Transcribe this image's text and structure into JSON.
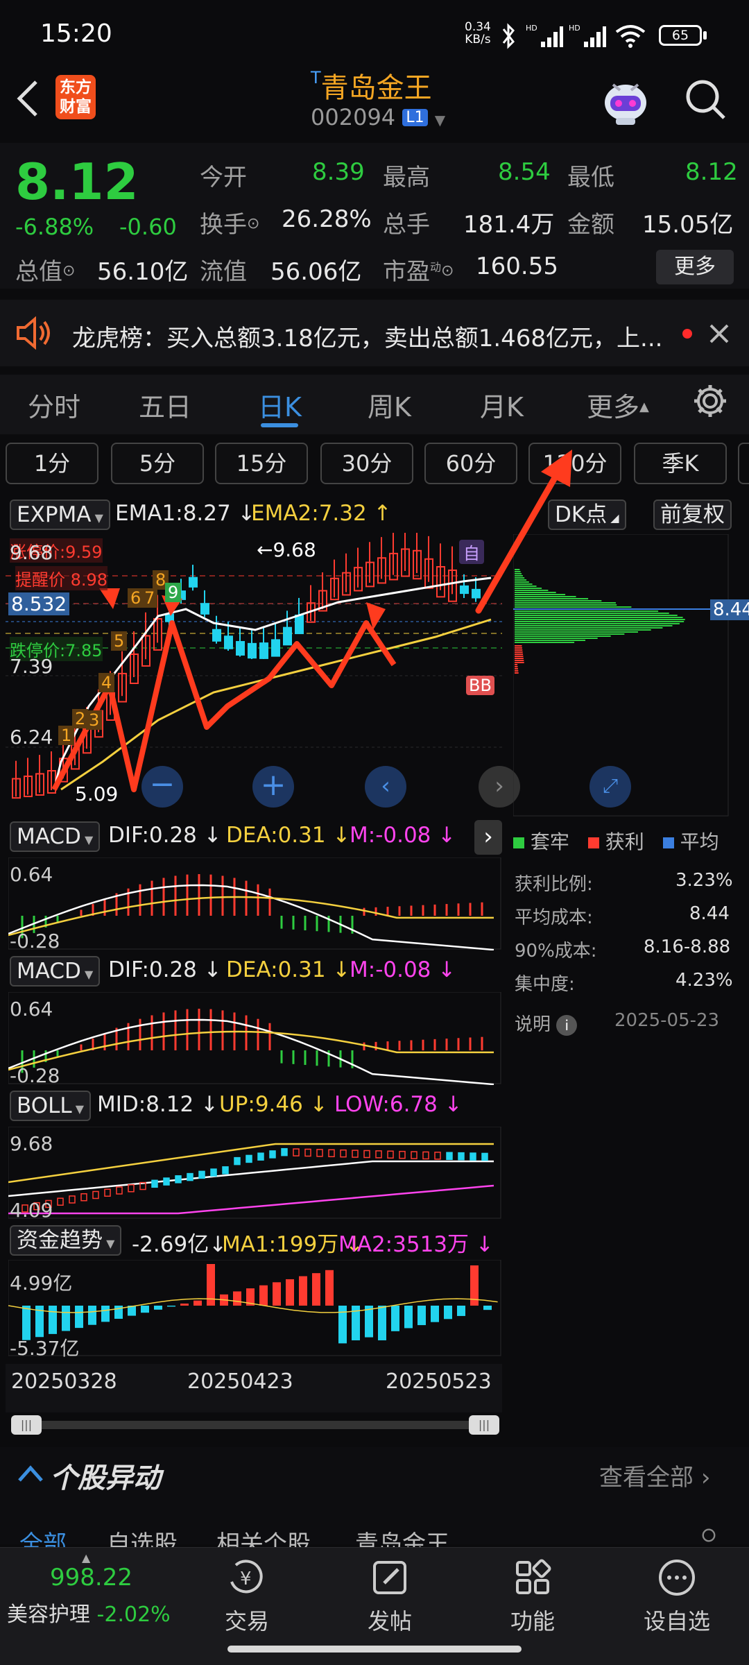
{
  "status_bar": {
    "time": "15:20",
    "net_speed_top": "0.34",
    "net_speed_bottom": "KB/s",
    "battery": "65"
  },
  "header": {
    "logo_line1": "东方",
    "logo_line2": "财富",
    "title_prefix": "T",
    "title": "青岛金王",
    "code": "002094",
    "level": "L1"
  },
  "quote": {
    "price": "8.12",
    "change_pct": "-6.88%",
    "change": "-0.60",
    "stats": [
      {
        "label": "今开",
        "value": "8.39",
        "color": "#2ecc40"
      },
      {
        "label": "最高",
        "value": "8.54",
        "color": "#2ecc40"
      },
      {
        "label": "最低",
        "value": "8.12",
        "color": "#2ecc40"
      },
      {
        "label": "换手",
        "value": "26.28%",
        "color": "#e8e8e8"
      },
      {
        "label": "总手",
        "value": "181.4万",
        "color": "#e8e8e8"
      },
      {
        "label": "金额",
        "value": "15.05亿",
        "color": "#e8e8e8"
      },
      {
        "label": "总值",
        "value": "56.10亿",
        "color": "#e8e8e8"
      },
      {
        "label": "流值",
        "value": "56.06亿",
        "color": "#e8e8e8"
      },
      {
        "label": "市盈",
        "value": "160.55",
        "color": "#e8e8e8"
      }
    ],
    "pe_sup": "动",
    "more": "更多"
  },
  "banner": {
    "text": "龙虎榜：买入总额3.18亿元，卖出总额1.468亿元，上..."
  },
  "tabs": [
    "分时",
    "五日",
    "日K",
    "周K",
    "月K",
    "更多"
  ],
  "active_tab": 2,
  "periods": [
    "1分",
    "5分",
    "15分",
    "30分",
    "60分",
    "120分",
    "季K"
  ],
  "main_chart": {
    "indicator": "EXPMA",
    "ema1": "EMA1:8.27",
    "ema2": "EMA2:7.32",
    "dk": "DK点",
    "adjust": "前复权",
    "ticks": [
      "9.68",
      "8.532",
      "7.39",
      "6.24",
      "5.09"
    ],
    "high_label": "9.68",
    "low_label": "5.09",
    "limit_up": "涨停价:9.59",
    "alert": "提醒价 8.98",
    "limit_down": "跌停价:7.85",
    "self_tag": "自",
    "bb_tag": "BB",
    "seq": [
      "1",
      "2",
      "3",
      "4",
      "5",
      "6",
      "7",
      "8",
      "9"
    ],
    "price_current": "8.532"
  },
  "chip": {
    "price": "8.44",
    "legend": [
      "套牢",
      "获利",
      "平均"
    ],
    "rows": [
      {
        "label": "获利比例:",
        "value": "3.23%"
      },
      {
        "label": "平均成本:",
        "value": "8.44"
      },
      {
        "label": "90%成本:",
        "value": "8.16-8.88"
      },
      {
        "label": "集中度:",
        "value": "4.23%"
      }
    ],
    "note_label": "说明",
    "date": "2025-05-23"
  },
  "macd1": {
    "name": "MACD",
    "dif": "DIF:0.28",
    "dea": "DEA:0.31",
    "m": "M:-0.08",
    "top": "0.64",
    "bottom": "-0.28"
  },
  "macd2": {
    "name": "MACD",
    "dif": "DIF:0.28",
    "dea": "DEA:0.31",
    "m": "M:-0.08",
    "top": "0.64",
    "bottom": "-0.28"
  },
  "boll": {
    "name": "BOLL",
    "mid": "MID:8.12",
    "up": "UP:9.46",
    "low": "LOW:6.78",
    "top": "9.68",
    "bottom": "4.09"
  },
  "fund": {
    "name": "资金趋势",
    "value": "-2.69亿",
    "ma1": "MA1:199万",
    "ma2": "MA2:3513万",
    "top": "4.99亿",
    "bottom": "-5.37亿"
  },
  "dates": [
    "20250328",
    "20250423",
    "20250523"
  ],
  "news": {
    "title": "个股异动",
    "view_all": "查看全部",
    "subtabs": [
      "全部",
      "自选股",
      "相关个股",
      "青岛金王"
    ]
  },
  "bottom_nav": {
    "index_value": "998.22",
    "index_name": "美容护理",
    "index_change": "-2.02%",
    "items": [
      "交易",
      "发帖",
      "功能",
      "设自选"
    ]
  },
  "colors": {
    "up": "#ff3b30",
    "down": "#2ecc40",
    "accent": "#f5a623",
    "cyan": "#22d3ee",
    "tab_active": "#3b8fe0"
  }
}
